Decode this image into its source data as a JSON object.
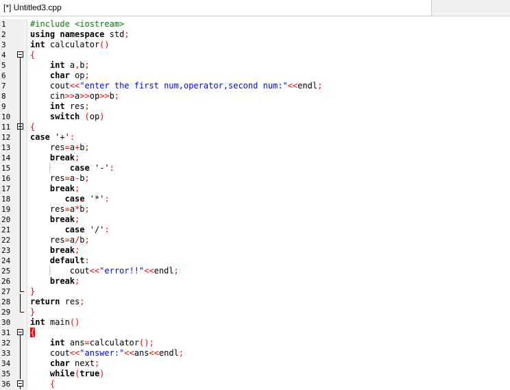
{
  "tab": {
    "title": "[*] Untitled3.cpp"
  },
  "colors": {
    "keyword": "#000000",
    "preprocessor": "#008000",
    "string": "#0000ff",
    "symbol": "#ff0000",
    "gutter": "#f0f0f0"
  },
  "lines": [
    {
      "n": "1",
      "t": "#include <iostream>"
    },
    {
      "n": "2",
      "t": "using namespace std;"
    },
    {
      "n": "3",
      "t": "int calculator()"
    },
    {
      "n": "4",
      "t": "{"
    },
    {
      "n": "5",
      "t": "    int a,b;"
    },
    {
      "n": "6",
      "t": "    char op;"
    },
    {
      "n": "7",
      "t": "    cout<<\"enter the first num,operator,second num:\"<<endl;"
    },
    {
      "n": "8",
      "t": "    cin>>a>>op>>b;"
    },
    {
      "n": "9",
      "t": "    int res;"
    },
    {
      "n": "10",
      "t": "    switch (op)"
    },
    {
      "n": "11",
      "t": "{"
    },
    {
      "n": "12",
      "t": "case '+':"
    },
    {
      "n": "13",
      "t": "    res=a+b;"
    },
    {
      "n": "14",
      "t": "    break;"
    },
    {
      "n": "15",
      "t": "        case '-':"
    },
    {
      "n": "16",
      "t": "    res=a-b;"
    },
    {
      "n": "17",
      "t": "    break;"
    },
    {
      "n": "18",
      "t": "       case '*':"
    },
    {
      "n": "19",
      "t": "    res=a*b;"
    },
    {
      "n": "20",
      "t": "    break;"
    },
    {
      "n": "21",
      "t": "       case '/':"
    },
    {
      "n": "22",
      "t": "    res=a/b;"
    },
    {
      "n": "23",
      "t": "    break;"
    },
    {
      "n": "24",
      "t": "    default:"
    },
    {
      "n": "25",
      "t": "        cout<<\"error!!\"<<endl;"
    },
    {
      "n": "26",
      "t": "    break;"
    },
    {
      "n": "27",
      "t": "}"
    },
    {
      "n": "28",
      "t": "return res;"
    },
    {
      "n": "29",
      "t": "}"
    },
    {
      "n": "30",
      "t": "int main()"
    },
    {
      "n": "31",
      "t": "{"
    },
    {
      "n": "32",
      "t": "    int ans=calculator();"
    },
    {
      "n": "33",
      "t": "    cout<<\"answer:\"<<ans<<endl;"
    },
    {
      "n": "34",
      "t": "    char next;"
    },
    {
      "n": "35",
      "t": "    while(true)"
    },
    {
      "n": "36",
      "t": "    {"
    }
  ]
}
